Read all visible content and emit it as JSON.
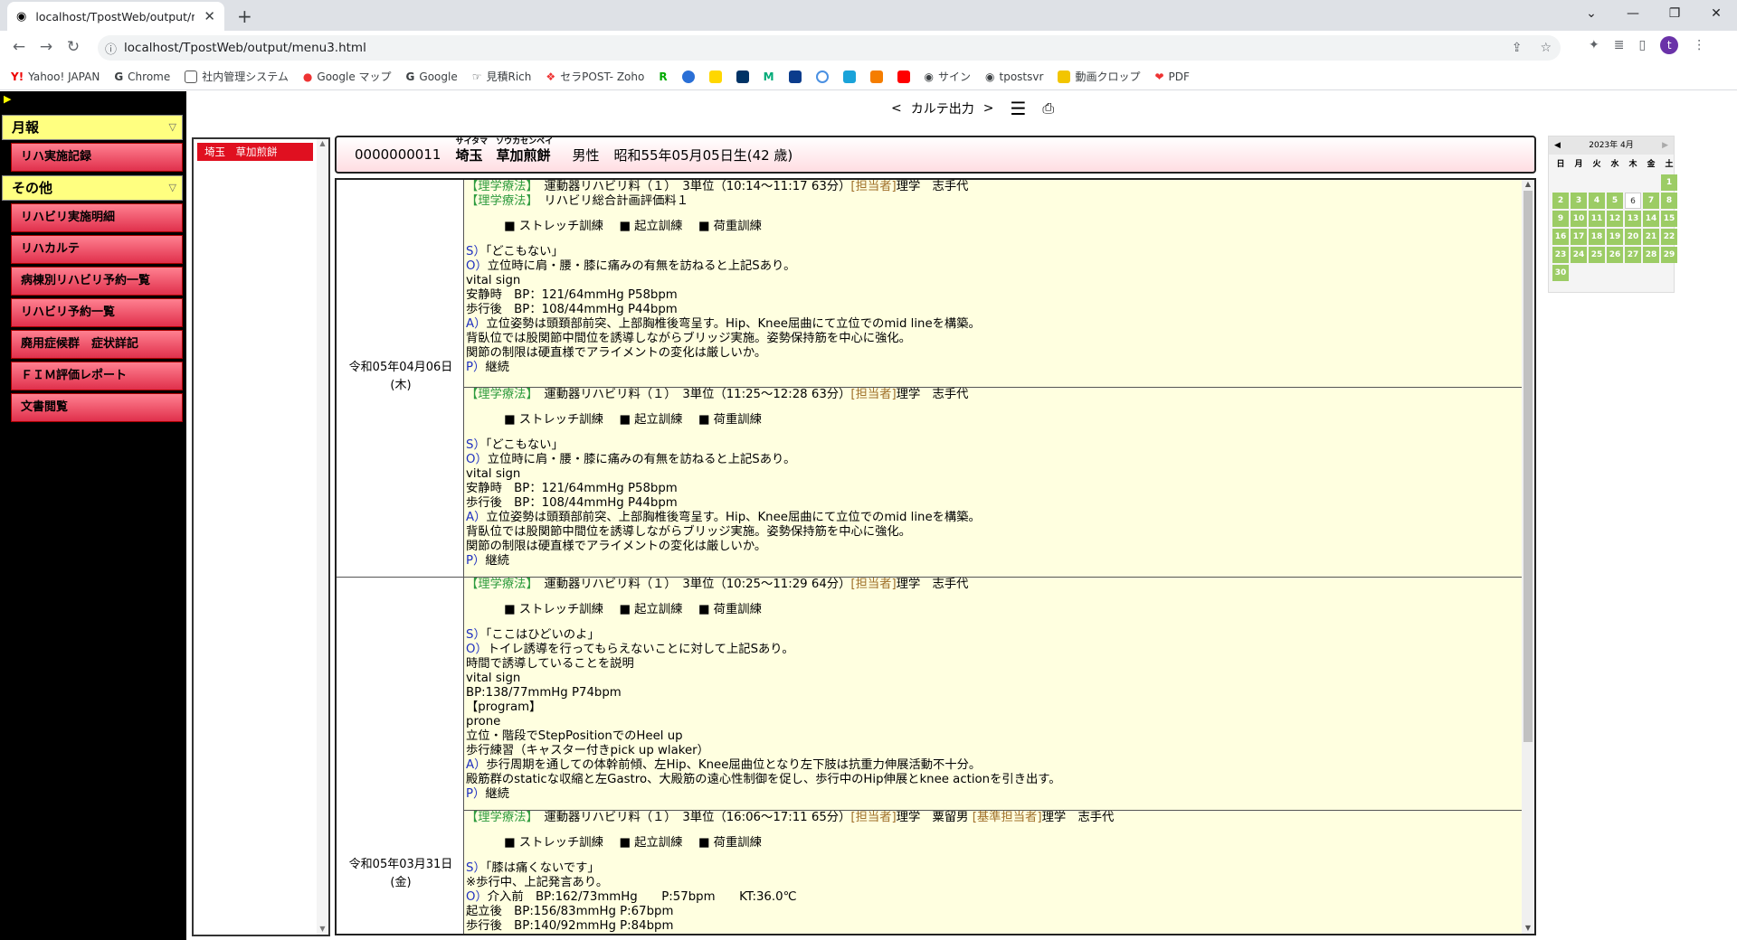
{
  "browser": {
    "tab_title": "localhost/TpostWeb/output/menu",
    "url": "localhost/TpostWeb/output/menu3.html",
    "avatar": "t"
  },
  "bookmarks": [
    "Yahoo! JAPAN",
    "Chrome",
    "社内管理システム",
    "Google マップ",
    "Google",
    "見積Rich",
    "セラPOST- Zoho",
    "サイン",
    "tpostsvr",
    "動画クロップ",
    "PDF"
  ],
  "sidebar": {
    "sections": [
      {
        "title": "月報",
        "items": [
          "リハ実施記録"
        ]
      },
      {
        "title": "その他",
        "items": [
          "リハビリ実施明細",
          "リハカルテ",
          "病棟別リハビリ予約一覧",
          "リハビリ予約一覧",
          "廃用症候群　症状詳記",
          "ＦＩＭ評価レポート",
          "文書閲覧"
        ]
      }
    ]
  },
  "patients": [
    "埼玉　草加煎餅"
  ],
  "page": {
    "prev": "<",
    "title": "カルテ出力",
    "next": ">"
  },
  "patient": {
    "id": "0000000011",
    "name": "埼玉　草加煎餅",
    "kana": "サイタマ　ソウカセンベイ",
    "sex": "男性",
    "dob": "昭和55年05月05日生(42 歳)"
  },
  "records": [
    {
      "date": "令和05年04月06日",
      "dow": "(木)"
    },
    {
      "date": "令和05年03月31日",
      "dow": "(金)"
    }
  ],
  "entries": [
    {
      "lines": [
        [
          [
            "grn",
            "【理学療法】"
          ],
          [
            "",
            "　運動器リハビリ料（１）　3単位（10:14～11:17 63分）"
          ],
          [
            "brn",
            "[担当者]"
          ],
          [
            "",
            "理学　志手代"
          ]
        ],
        [
          [
            "grn",
            "【理学療法】"
          ],
          [
            "",
            "　リハビリ総合計画評価料１"
          ]
        ],
        "GAP",
        "IND:■ ストレッチ訓練　 ■ 起立訓練　 ■ 荷重訓練",
        "GAP",
        [
          [
            "blu",
            "S）"
          ],
          [
            "",
            "「どこもない」"
          ]
        ],
        [
          [
            "blu",
            "O）"
          ],
          [
            "",
            "立位時に肩・腰・膝に痛みの有無を訪ねると上記Sあり。"
          ]
        ],
        "vital sign",
        "安静時　BP：121/64mmHg P58bpm",
        "歩行後　BP：108/44mmHg P44bpm",
        [
          [
            "blu",
            "A）"
          ],
          [
            "",
            "立位姿勢は頭頚部前突、上部胸椎後弯呈す。Hip、Knee屈曲にて立位でのmid lineを構築。"
          ]
        ],
        "背臥位では股関節中間位を誘導しながらブリッジ実施。姿勢保持筋を中心に強化。",
        "関節の制限は硬直様でアライメントの変化は厳しいか。",
        [
          [
            "blu",
            "P）"
          ],
          [
            "",
            "継続"
          ]
        ]
      ]
    },
    {
      "lines": [
        [
          [
            "grn",
            "【理学療法】"
          ],
          [
            "",
            "　運動器リハビリ料（１）　3単位（11:25～12:28 63分）"
          ],
          [
            "brn",
            "[担当者]"
          ],
          [
            "",
            "理学　志手代"
          ]
        ],
        "GAP",
        "IND:■ ストレッチ訓練　 ■ 起立訓練　 ■ 荷重訓練",
        "GAP",
        [
          [
            "blu",
            "S）"
          ],
          [
            "",
            "「どこもない」"
          ]
        ],
        [
          [
            "blu",
            "O）"
          ],
          [
            "",
            "立位時に肩・腰・膝に痛みの有無を訪ねると上記Sあり。"
          ]
        ],
        "vital sign",
        "安静時　BP：121/64mmHg P58bpm",
        "歩行後　BP：108/44mmHg P44bpm",
        [
          [
            "blu",
            "A）"
          ],
          [
            "",
            "立位姿勢は頭頚部前突、上部胸椎後弯呈す。Hip、Knee屈曲にて立位でのmid lineを構築。"
          ]
        ],
        "背臥位では股関節中間位を誘導しながらブリッジ実施。姿勢保持筋を中心に強化。",
        "関節の制限は硬直様でアライメントの変化は厳しいか。",
        [
          [
            "blu",
            "P）"
          ],
          [
            "",
            "継続"
          ]
        ]
      ]
    },
    {
      "lines": [
        [
          [
            "grn",
            "【理学療法】"
          ],
          [
            "",
            "　運動器リハビリ料（１）　3単位（10:25～11:29 64分）"
          ],
          [
            "brn",
            "[担当者]"
          ],
          [
            "",
            "理学　志手代"
          ]
        ],
        "GAP",
        "IND:■ ストレッチ訓練　 ■ 起立訓練　 ■ 荷重訓練",
        "GAP",
        [
          [
            "blu",
            "S）"
          ],
          [
            "",
            "「ここはひどいのよ」"
          ]
        ],
        [
          [
            "blu",
            "O）"
          ],
          [
            "",
            "トイレ誘導を行ってもらえないことに対して上記Sあり。"
          ]
        ],
        "時間で誘導していることを説明",
        "vital sign",
        "BP:138/77mmHg P74bpm",
        "【program】",
        "prone",
        "立位・階段でStepPositionでのHeel up",
        "歩行練習（キャスター付きpick up wlaker）",
        [
          [
            "blu",
            "A）"
          ],
          [
            "",
            "歩行周期を通しての体幹前傾、左Hip、Knee屈曲位となり左下肢は抗重力伸展活動不十分。"
          ]
        ],
        "殿筋群のstaticな収縮と左Gastro、大殿筋の遠心性制御を促し、歩行中のHip伸展とknee actionを引き出す。",
        [
          [
            "blu",
            "P）"
          ],
          [
            "",
            "継続"
          ]
        ]
      ]
    },
    {
      "lines": [
        [
          [
            "grn",
            "【理学療法】"
          ],
          [
            "",
            "　運動器リハビリ料（１）　3単位（16:06～17:11 65分）"
          ],
          [
            "brn",
            "[担当者]"
          ],
          [
            "",
            "理学　粟留男 "
          ],
          [
            "brn",
            "[基準担当者]"
          ],
          [
            "",
            "理学　志手代"
          ]
        ],
        "GAP",
        "IND:■ ストレッチ訓練　 ■ 起立訓練　 ■ 荷重訓練",
        "GAP",
        [
          [
            "blu",
            "S）"
          ],
          [
            "",
            "「膝は痛くないです」"
          ]
        ],
        "※歩行中、上記発言あり。",
        [
          [
            "blu",
            "O）"
          ],
          [
            "",
            "介入前　BP:162/73mmHg　　P:57bpm　　KT:36.0℃"
          ]
        ],
        "起立後　BP:156/83mmHg P:67bpm",
        "歩行後　BP:140/92mmHg P:84bpm"
      ]
    }
  ],
  "calendar": {
    "title": "2023年 4月",
    "dows": [
      "日",
      "月",
      "火",
      "水",
      "木",
      "金",
      "土"
    ],
    "days": [
      "1",
      "2",
      "3",
      "4",
      "5",
      "6",
      "7",
      "8",
      "9",
      "10",
      "11",
      "12",
      "13",
      "14",
      "15",
      "16",
      "17",
      "18",
      "19",
      "20",
      "21",
      "22",
      "23",
      "24",
      "25",
      "26",
      "27",
      "28",
      "29",
      "30"
    ],
    "today": "6"
  }
}
